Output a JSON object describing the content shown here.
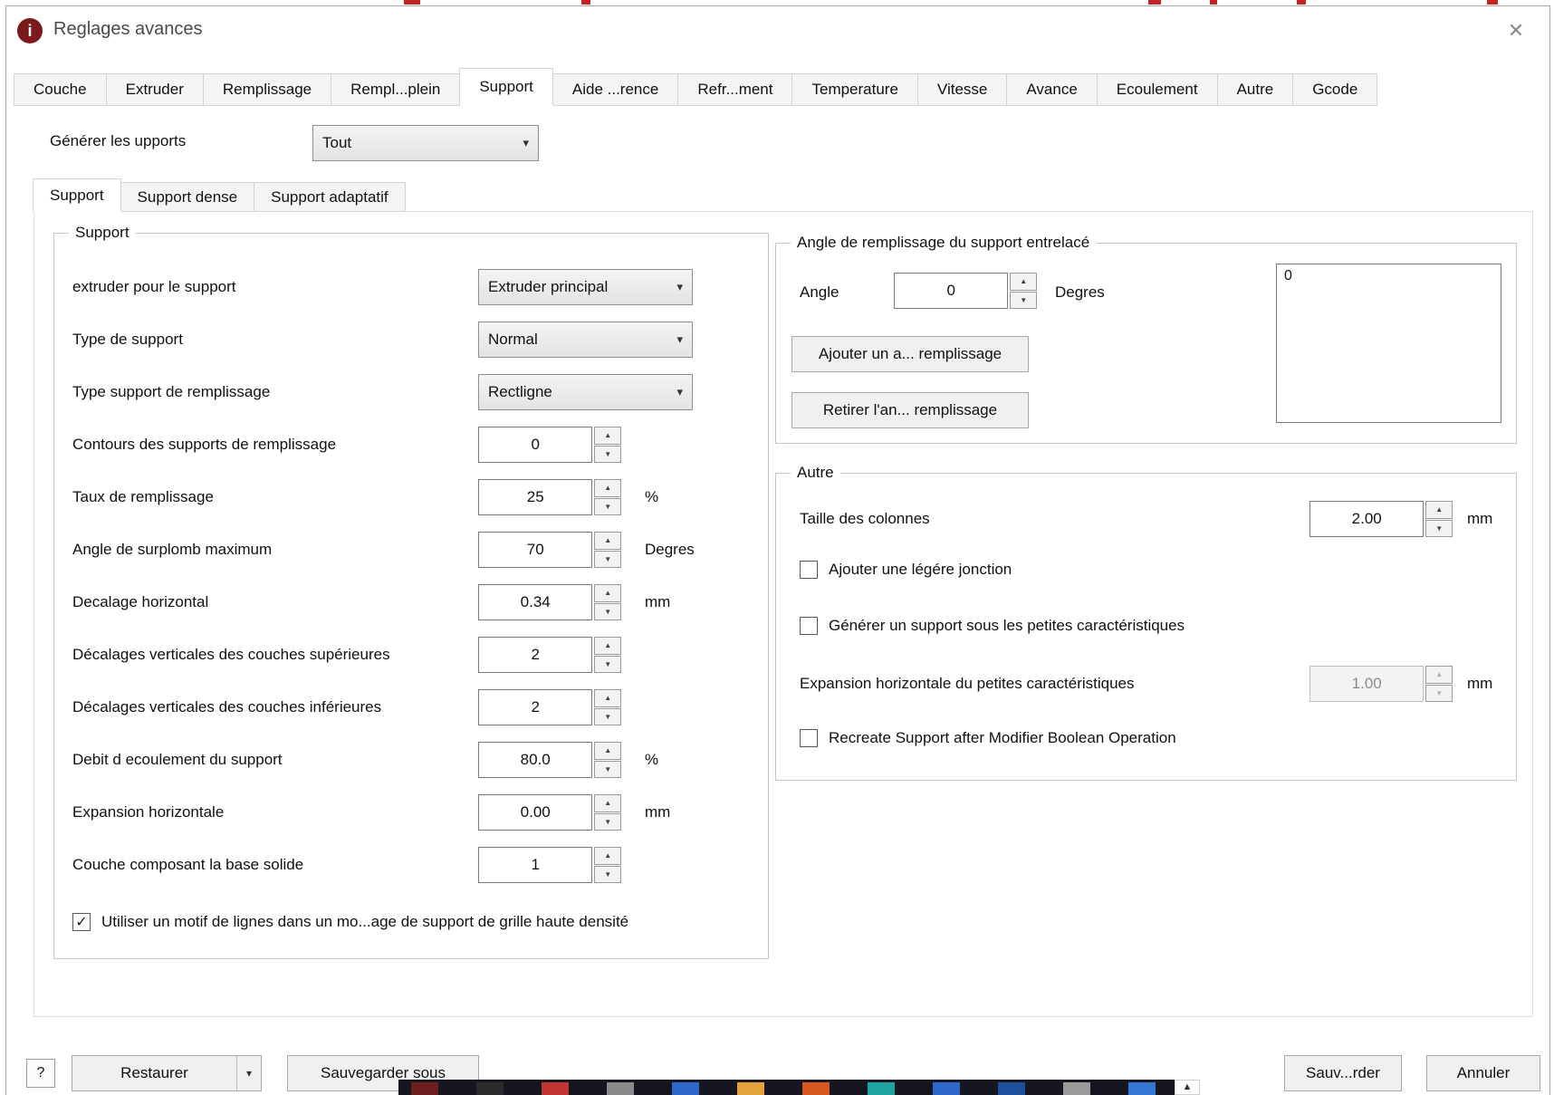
{
  "window": {
    "title": "Reglages avances",
    "close": "✕",
    "icon": "i"
  },
  "tabs": [
    "Couche",
    "Extruder",
    "Remplissage",
    "Rempl...plein",
    "Support",
    "Aide ...rence",
    "Refr...ment",
    "Temperature",
    "Vitesse",
    "Avance",
    "Ecoulement",
    "Autre",
    "Gcode"
  ],
  "generate": {
    "label": "Générer les upports",
    "value": "Tout"
  },
  "subtabs": [
    "Support",
    "Support dense",
    "Support adaptatif"
  ],
  "support": {
    "title": "Support",
    "extruder_label": "extruder pour le support",
    "extruder_value": "Extruder principal",
    "type_label": "Type de support",
    "type_value": "Normal",
    "infill_type_label": "Type support de remplissage",
    "infill_type_value": "Rectligne",
    "outline_label": "Contours des supports de remplissage",
    "outline_value": "0",
    "infill_pct_label": "Taux de remplissage",
    "infill_pct_value": "25",
    "infill_pct_unit": "%",
    "overhang_label": "Angle de surplomb maximum",
    "overhang_value": "70",
    "overhang_unit": "Degres",
    "offset_label": "Decalage horizontal",
    "offset_value": "0.34",
    "offset_unit": "mm",
    "upper_label": "Décalages verticales des couches supérieures",
    "upper_value": "2",
    "lower_label": "Décalages verticales des couches inférieures",
    "lower_value": "2",
    "flow_label": "Debit d ecoulement du support",
    "flow_value": "80.0",
    "flow_unit": "%",
    "hexp_label": "Expansion horizontale",
    "hexp_value": "0.00",
    "hexp_unit": "mm",
    "base_label": "Couche composant la base solide",
    "base_value": "1",
    "checkbox_label": "Utiliser un motif de lignes dans un mo...age de support de grille haute densité"
  },
  "angle_group": {
    "title": "Angle de remplissage du support entrelacé",
    "angle_label": "Angle",
    "angle_value": "0",
    "angle_unit": "Degres",
    "add_button": "Ajouter un a... remplissage",
    "remove_button": "Retirer l'an... remplissage",
    "list_items": [
      "0"
    ]
  },
  "autre": {
    "title": "Autre",
    "pillar_label": "Taille des colonnes",
    "pillar_value": "2.00",
    "pillar_unit": "mm",
    "joint_label": "Ajouter une légére jonction",
    "small_label": "Générer un support sous les petites caractéristiques",
    "small_exp_label": "Expansion horizontale du petites caractéristiques",
    "small_exp_value": "1.00",
    "small_exp_unit": "mm",
    "recreate_label": "Recreate Support after Modifier Boolean Operation"
  },
  "footer": {
    "help": "?",
    "restore": "Restaurer",
    "save_as": "Sauvegarder sous",
    "save": "Sauv...rder",
    "cancel": "Annuler"
  },
  "taskbar": {
    "background": "#15161f",
    "icon_colors": [
      "#6d1f1f",
      "#2b2b2b",
      "#c13535",
      "#8a8a8a",
      "#2e66c9",
      "#e3a23c",
      "#d4581f",
      "#1fa3a3",
      "#2e66c9",
      "#1d4f9c",
      "#9a9a9a",
      "#3578d4"
    ]
  }
}
